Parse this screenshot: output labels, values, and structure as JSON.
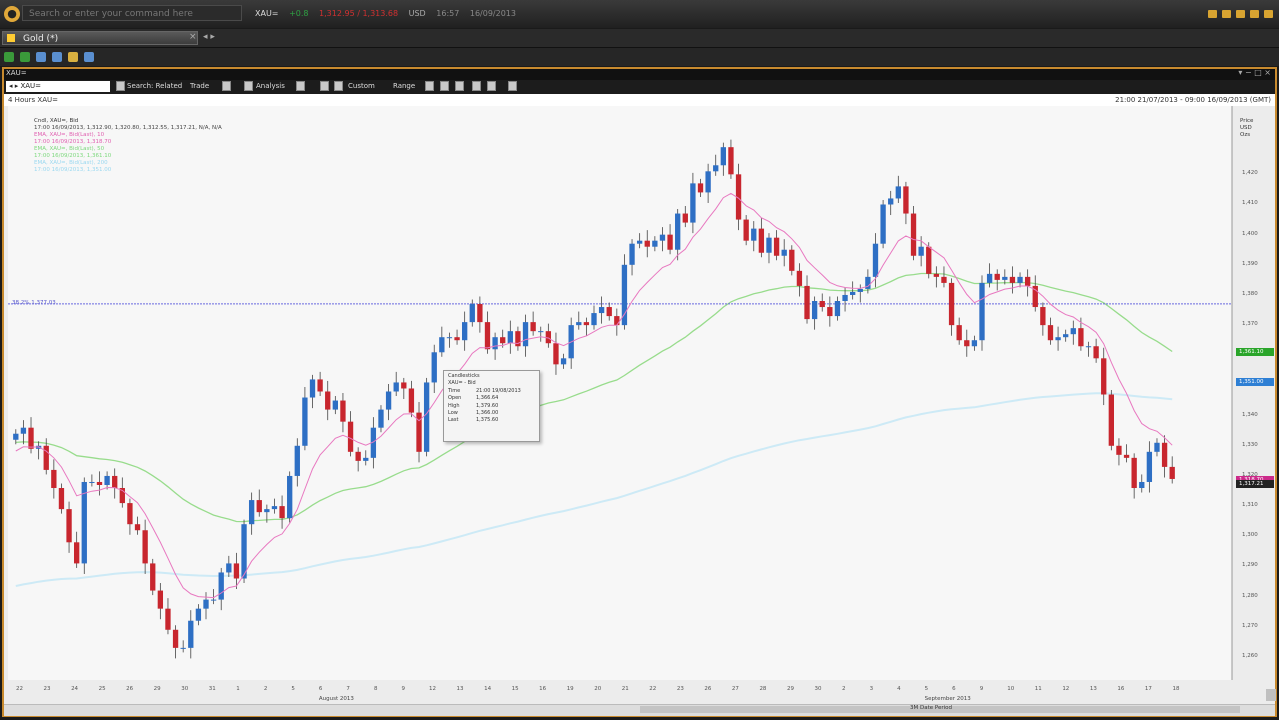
{
  "app": {
    "logo_char": "●",
    "command_placeholder": "Search or enter your command here",
    "quote": {
      "ric": "XAU=",
      "change": "+0.8",
      "bid_ask": "1,312.95 / 1,313.68",
      "currency": "USD",
      "time": "16:57",
      "date": "16/09/2013"
    },
    "top_icons": [
      "mail-icon",
      "folder-icon",
      "home-icon",
      "user-icon",
      "settings-icon"
    ]
  },
  "tab": {
    "label": "Gold (*)",
    "close": "×",
    "arrows": "◂ ▸"
  },
  "chart_window": {
    "title": "XAU=",
    "controls": "▾ − □ ×",
    "ric_input": "◂ ▸ XAU=",
    "toolbar": {
      "search": "Search: Related",
      "trade": "Trade",
      "analysis": "Analysis",
      "custom": "Custom",
      "range": "Range"
    },
    "header_left": "4 Hours XAU=",
    "header_right": "21:00 21/07/2013 - 09:00 16/09/2013 (GMT)",
    "y_axis_header": [
      "Price",
      "USD",
      "Ozs"
    ],
    "period_label": "3M Date Period"
  },
  "legend": [
    "Cndl, XAU=, Bid",
    "17:00 16/09/2013, 1,312.90, 1,320.80, 1,312.55, 1,317.21, N/A, N/A",
    "EMA, XAU=, Bid(Last), 10",
    "17:00 16/09/2013, 1,318.70",
    "EMA, XAU=, Bid(Last), 50",
    "17:00 16/09/2013, 1,361.10",
    "EMA, XAU=, Bid(Last), 200",
    "17:00 16/09/2013, 1,351.00"
  ],
  "fib_label": "38.2% 1,377.03",
  "tooltip": {
    "title": "Candlesticks",
    "series": "XAU= - Bid",
    "rows": [
      [
        "Time",
        "21:00 19/08/2013"
      ],
      [
        "Open",
        "1,366.64"
      ],
      [
        "High",
        "1,379.60"
      ],
      [
        "Low",
        "1,366.00"
      ],
      [
        "Last",
        "1,375.60"
      ]
    ]
  },
  "colors": {
    "frame": "#c88a2e",
    "up": "#2e6fc4",
    "down": "#c8262e",
    "ema10": "#e878c0",
    "ema50": "#98dc8c",
    "ema200": "#cdeaf6",
    "fib": "#6868e0"
  },
  "chart_data": {
    "type": "candlestick",
    "title": "4 Hours XAU=",
    "ylabel": "Price USD Ozs",
    "ylim": [
      1255,
      1440
    ],
    "x_ticks": [
      "22",
      "23",
      "24",
      "25",
      "26",
      "29",
      "30",
      "31",
      "1",
      "2",
      "5",
      "6",
      "7",
      "8",
      "9",
      "12",
      "13",
      "14",
      "15",
      "16",
      "19",
      "20",
      "21",
      "22",
      "23",
      "26",
      "27",
      "28",
      "29",
      "30",
      "2",
      "3",
      "4",
      "5",
      "6",
      "9",
      "10",
      "11",
      "12",
      "13",
      "16",
      "17",
      "18"
    ],
    "month_labels": [
      {
        "label": "August 2013",
        "at_tick": 11
      },
      {
        "label": "September 2013",
        "at_tick": 33
      }
    ],
    "y_ticks": [
      "1,420",
      "1,410",
      "1,400",
      "1,390",
      "1,380",
      "1,370",
      "1,360",
      "1,350",
      "1,340",
      "1,330",
      "1,320",
      "1,310",
      "1,300",
      "1,290",
      "1,280",
      "1,270",
      "1,260"
    ],
    "badges": [
      {
        "text": "1,361.10",
        "value": 1361.1,
        "color": "#2aa52a"
      },
      {
        "text": "1,351.00",
        "value": 1351.0,
        "color": "#2e7fd4"
      },
      {
        "text": "1,318.70",
        "value": 1318.7,
        "color": "#cc2a8a"
      },
      {
        "text": "1,317.21",
        "value": 1317.21,
        "color": "#222222"
      }
    ],
    "fib_level": 1377.03,
    "ohlc_close": [
      1334,
      1336,
      1329,
      1330,
      1322,
      1316,
      1309,
      1298,
      1291,
      1318,
      1318,
      1317,
      1320,
      1316,
      1311,
      1304,
      1302,
      1291,
      1282,
      1276,
      1269,
      1263,
      1263,
      1272,
      1276,
      1279,
      1279,
      1288,
      1291,
      1286,
      1304,
      1312,
      1308,
      1309,
      1310,
      1306,
      1320,
      1330,
      1346,
      1352,
      1348,
      1342,
      1345,
      1338,
      1328,
      1325,
      1326,
      1336,
      1342,
      1348,
      1351,
      1349,
      1341,
      1328,
      1351,
      1361,
      1366,
      1366,
      1365,
      1371,
      1377,
      1371,
      1362,
      1366,
      1364,
      1368,
      1363,
      1371,
      1368,
      1368,
      1364,
      1357,
      1359,
      1370,
      1371,
      1370,
      1374,
      1376,
      1373,
      1370,
      1390,
      1397,
      1398,
      1396,
      1398,
      1400,
      1395,
      1407,
      1404,
      1417,
      1414,
      1421,
      1423,
      1429,
      1420,
      1405,
      1398,
      1402,
      1394,
      1399,
      1393,
      1395,
      1388,
      1383,
      1372,
      1378,
      1376,
      1373,
      1378,
      1380,
      1381,
      1382,
      1386,
      1397,
      1410,
      1412,
      1416,
      1407,
      1393,
      1396,
      1387,
      1386,
      1384,
      1370,
      1365,
      1363,
      1365,
      1384,
      1387,
      1385,
      1386,
      1384,
      1386,
      1383,
      1376,
      1370,
      1365,
      1366,
      1367,
      1369,
      1363,
      1363,
      1359,
      1347,
      1330,
      1327,
      1326,
      1316,
      1318,
      1328,
      1331,
      1323,
      1319
    ],
    "ema10_first": 1327,
    "ema50_first": 1331,
    "ema200_first": 1283
  }
}
